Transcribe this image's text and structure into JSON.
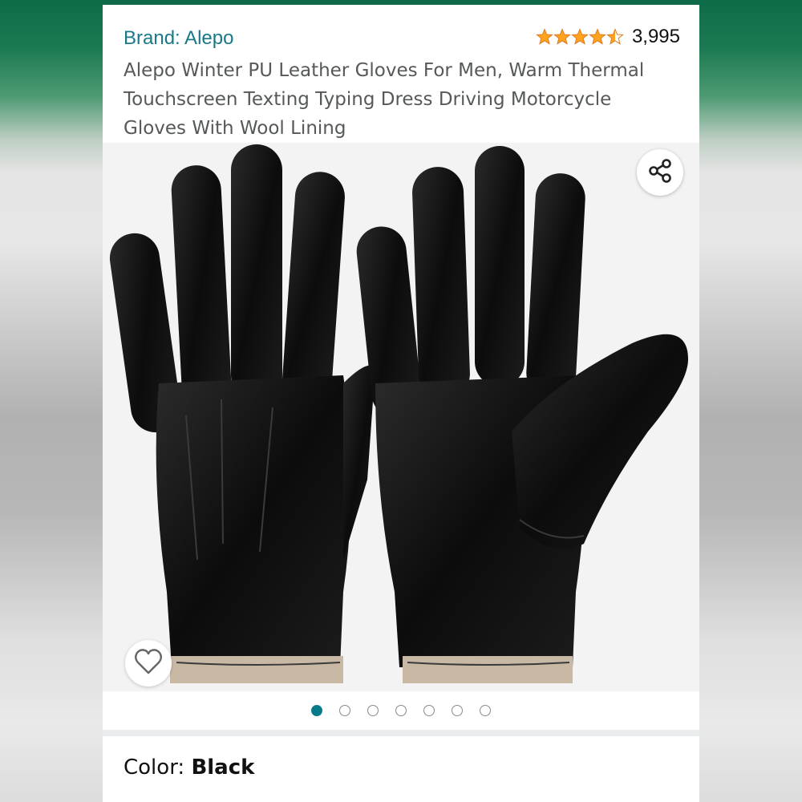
{
  "product": {
    "brand_link": "Brand: Alepo",
    "rating_value": 4.5,
    "rating_count": "3,995",
    "title": "Alepo Winter PU Leather Gloves For Men, Warm Thermal Touchscreen Texting Typing Dress Driving Motorcycle Gloves With Wool Lining"
  },
  "gallery": {
    "image_subject": "black leather gloves",
    "total_images": 7,
    "active_index": 0,
    "share_icon": "share-icon",
    "wishlist_icon": "heart-outline-icon"
  },
  "variation": {
    "color_label": "Color: ",
    "color_value": "Black"
  },
  "colors": {
    "brand_link": "#1a7889",
    "star": "#ffa41c",
    "active_dot": "#087a8a",
    "title_text": "#565959"
  }
}
